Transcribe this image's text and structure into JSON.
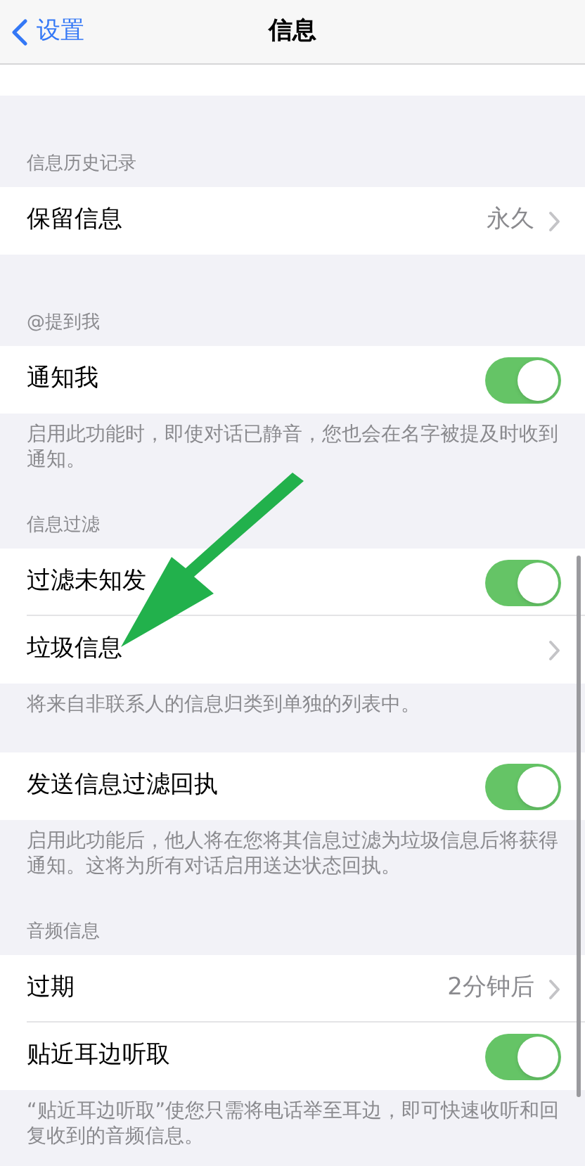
{
  "nav": {
    "back": "设置",
    "title": "信息"
  },
  "sections": [
    {
      "rows": [
        {
          "kind": "blank"
        }
      ]
    },
    {
      "header": "信息历史记录",
      "rows": [
        {
          "label": "保留信息",
          "kind": "link",
          "value": "永久"
        }
      ]
    },
    {
      "header": "@提到我",
      "rows": [
        {
          "label": "通知我",
          "kind": "toggle",
          "on": true
        }
      ],
      "footer": "启用此功能时，即使对话已静音，您也会在名字被提及时收到通知。"
    },
    {
      "header": "信息过滤",
      "rows": [
        {
          "label": "过滤未知发",
          "kind": "toggle",
          "on": true
        },
        {
          "label": "垃圾信息",
          "kind": "link"
        }
      ],
      "footer": "将来自非联系人的信息归类到单独的列表中。"
    },
    {
      "rows": [
        {
          "label": "发送信息过滤回执",
          "kind": "toggle",
          "on": true
        }
      ],
      "footer": "启用此功能后，他人将在您将其信息过滤为垃圾信息后将获得通知。这将为所有对话启用送达状态回执。"
    },
    {
      "header": "音频信息",
      "rows": [
        {
          "label": "过期",
          "kind": "link",
          "value": "2分钟后"
        },
        {
          "label": "贴近耳边听取",
          "kind": "toggle",
          "on": true
        }
      ],
      "footer": "“贴近耳边听取”使您只需将电话举至耳边，即可快速收听和回复收到的音频信息。"
    }
  ]
}
